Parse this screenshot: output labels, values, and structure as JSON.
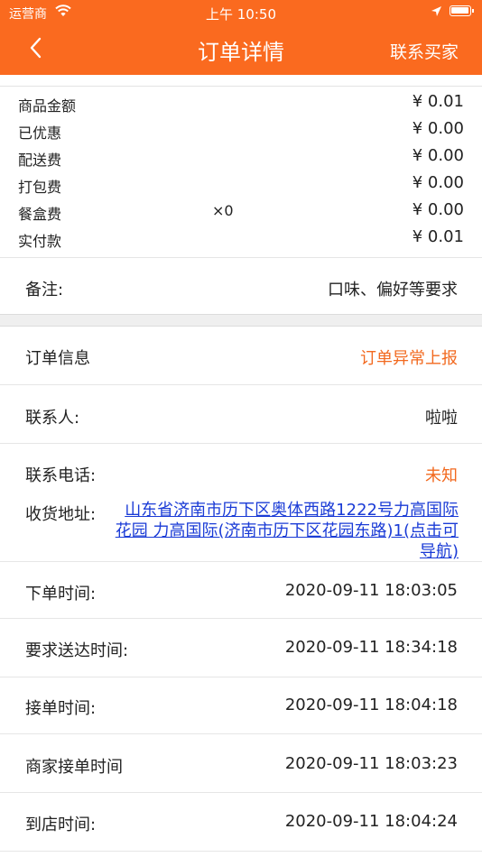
{
  "status_bar": {
    "carrier": "运营商",
    "time": "上午 10:50"
  },
  "nav": {
    "title": "订单详情",
    "right_action": "联系买家",
    "back_icon": "chevron-left-icon"
  },
  "fees": [
    {
      "label": "商品金额",
      "qty": "",
      "value": "¥ 0.01"
    },
    {
      "label": "已优惠",
      "qty": "",
      "value": "¥ 0.00"
    },
    {
      "label": "配送费",
      "qty": "",
      "value": "¥ 0.00"
    },
    {
      "label": "打包费",
      "qty": "",
      "value": "¥ 0.00"
    },
    {
      "label": "餐盒费",
      "qty": "×0",
      "value": "¥ 0.00"
    },
    {
      "label": "实付款",
      "qty": "",
      "value": "¥ 0.01"
    }
  ],
  "remark": {
    "label": "备注:",
    "value": "口味、偏好等要求"
  },
  "order_info": {
    "label": "订单信息",
    "action": "订单异常上报"
  },
  "contact": {
    "label": "联系人:",
    "value": "啦啦"
  },
  "phone": {
    "label": "联系电话:",
    "value": "未知"
  },
  "address": {
    "label": "收货地址:",
    "value": "山东省济南市历下区奥体西路1222号力高国际花园 力高国际(济南市历下区花园东路)1(点击可导航)"
  },
  "times": [
    {
      "label": "下单时间:",
      "value": "2020-09-11 18:03:05"
    },
    {
      "label": "要求送达时间:",
      "value": "2020-09-11 18:34:18"
    },
    {
      "label": "接单时间:",
      "value": "2020-09-11 18:04:18"
    },
    {
      "label": "商家接单时间",
      "value": "2020-09-11 18:03:23"
    },
    {
      "label": "到店时间:",
      "value": "2020-09-11 18:04:24"
    }
  ],
  "colors": {
    "brand": "#fa6a1f",
    "accent_text": "#f2691f",
    "link": "#1a3bd6"
  }
}
